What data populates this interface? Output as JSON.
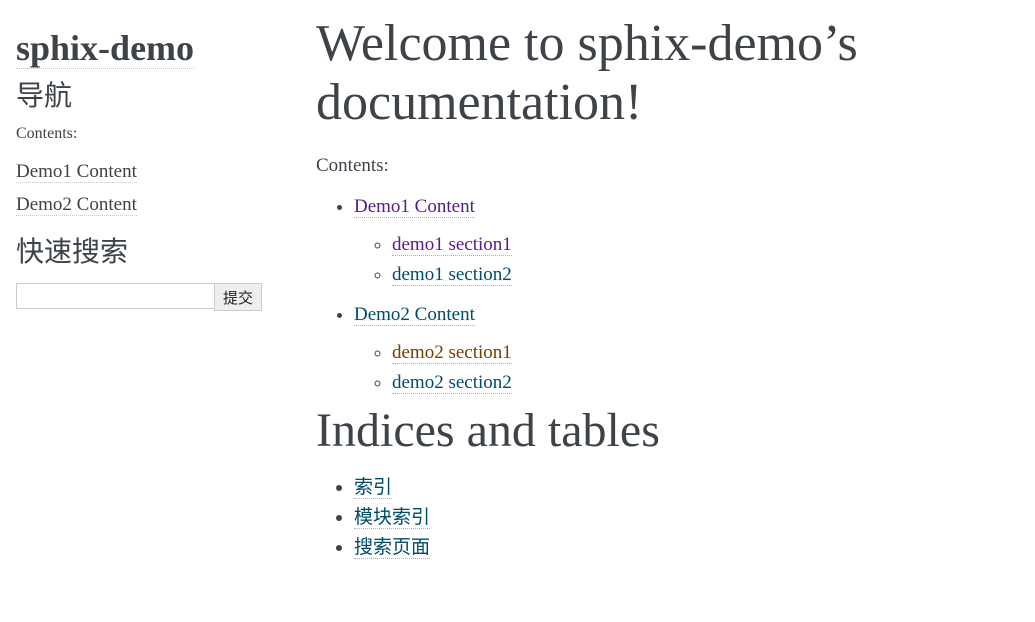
{
  "sidebar": {
    "logo": "sphix-demo",
    "nav_heading": "导航",
    "contents_caption": "Contents:",
    "nav_items": [
      {
        "label": "Demo1 Content"
      },
      {
        "label": "Demo2 Content"
      }
    ],
    "search_heading": "快速搜索",
    "search": {
      "value": "",
      "placeholder": "",
      "submit_label": "提交"
    }
  },
  "main": {
    "title": "Welcome to sphix-demo’s documentation!",
    "contents_caption": "Contents:",
    "toc": [
      {
        "label": "Demo1 Content",
        "color": "#551a8b",
        "children": [
          {
            "label": "demo1 section1",
            "color": "#551a8b"
          },
          {
            "label": "demo1 section2",
            "color": "#004b6b"
          }
        ]
      },
      {
        "label": "Demo2 Content",
        "color": "#004b6b",
        "children": [
          {
            "label": "demo2 section1",
            "color": "#6d4100"
          },
          {
            "label": "demo2 section2",
            "color": "#004b6b"
          }
        ]
      }
    ],
    "indices_heading": "Indices and tables",
    "indices": [
      {
        "label": "索引"
      },
      {
        "label": "模块索引"
      },
      {
        "label": "搜索页面"
      }
    ],
    "link_color": "#004b6b"
  }
}
